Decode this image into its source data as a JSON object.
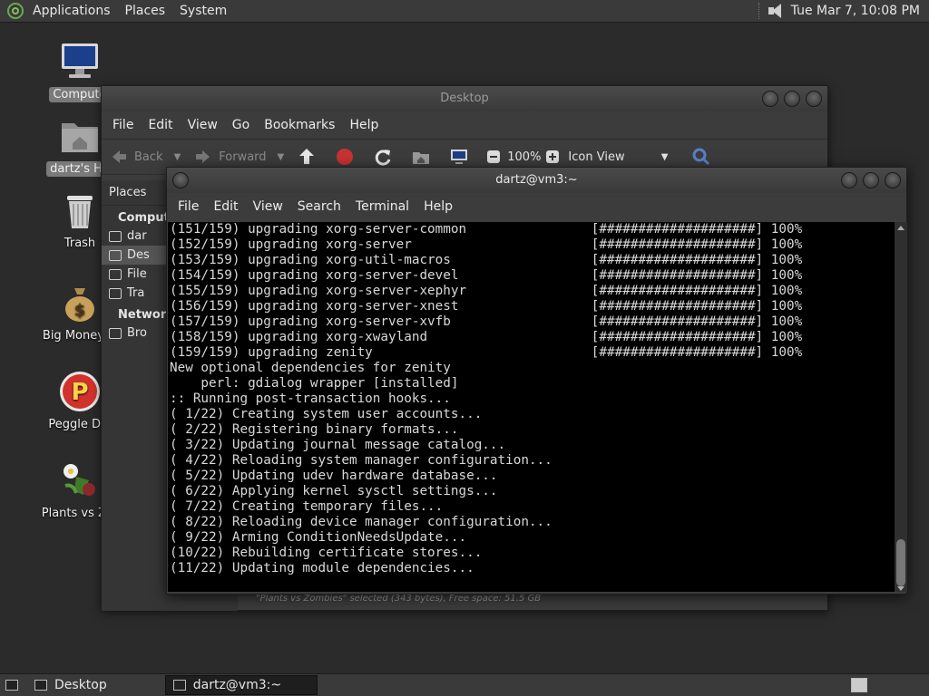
{
  "top_panel": {
    "menus": [
      "Applications",
      "Places",
      "System"
    ],
    "clock": "Tue Mar  7, 10:08 PM"
  },
  "desktop_icons": [
    {
      "name": "computer",
      "label": "Compute",
      "selected": true
    },
    {
      "name": "home",
      "label": "dartz's Ho",
      "selected": true
    },
    {
      "name": "trash",
      "label": "Trash",
      "selected": false
    },
    {
      "name": "big-money",
      "label": "Big Money D",
      "selected": false
    },
    {
      "name": "peggle",
      "label": "Peggle Del",
      "selected": false
    },
    {
      "name": "plants-vs-zombies",
      "label": "Plants vs Zor",
      "selected": false
    }
  ],
  "file_manager": {
    "title": "Desktop",
    "menus": [
      "File",
      "Edit",
      "View",
      "Go",
      "Bookmarks",
      "Help"
    ],
    "toolbar": {
      "back": "Back",
      "forward": "Forward",
      "zoom": "100%",
      "view_mode": "Icon View"
    },
    "sidebar": {
      "header": "Places",
      "sections": [
        {
          "title": "Compute",
          "items": [
            "dar",
            "Des",
            "File",
            "Tra"
          ]
        },
        {
          "title": "Network",
          "items": [
            "Bro"
          ]
        }
      ]
    },
    "status": "\"Plants vs Zombies\" selected (343 bytes), Free space: 51.5 GB"
  },
  "terminal": {
    "title": "dartz@vm3:~",
    "menus": [
      "File",
      "Edit",
      "View",
      "Search",
      "Terminal",
      "Help"
    ],
    "lines": [
      "(151/159) upgrading xorg-server-common                [####################] 100%",
      "(152/159) upgrading xorg-server                       [####################] 100%",
      "(153/159) upgrading xorg-util-macros                  [####################] 100%",
      "(154/159) upgrading xorg-server-devel                 [####################] 100%",
      "(155/159) upgrading xorg-server-xephyr                [####################] 100%",
      "(156/159) upgrading xorg-server-xnest                 [####################] 100%",
      "(157/159) upgrading xorg-server-xvfb                  [####################] 100%",
      "(158/159) upgrading xorg-xwayland                     [####################] 100%",
      "(159/159) upgrading zenity                            [####################] 100%",
      "New optional dependencies for zenity",
      "    perl: gdialog wrapper [installed]",
      ":: Running post-transaction hooks...",
      "( 1/22) Creating system user accounts...",
      "( 2/22) Registering binary formats...",
      "( 3/22) Updating journal message catalog...",
      "( 4/22) Reloading system manager configuration...",
      "( 5/22) Updating udev hardware database...",
      "( 6/22) Applying kernel sysctl settings...",
      "( 7/22) Creating temporary files...",
      "( 8/22) Reloading device manager configuration...",
      "( 9/22) Arming ConditionNeedsUpdate...",
      "(10/22) Rebuilding certificate stores...",
      "(11/22) Updating module dependencies..."
    ]
  },
  "taskbar": {
    "tasks": [
      {
        "label": "Desktop",
        "active": false
      },
      {
        "label": "dartz@vm3:~",
        "active": true
      }
    ]
  }
}
